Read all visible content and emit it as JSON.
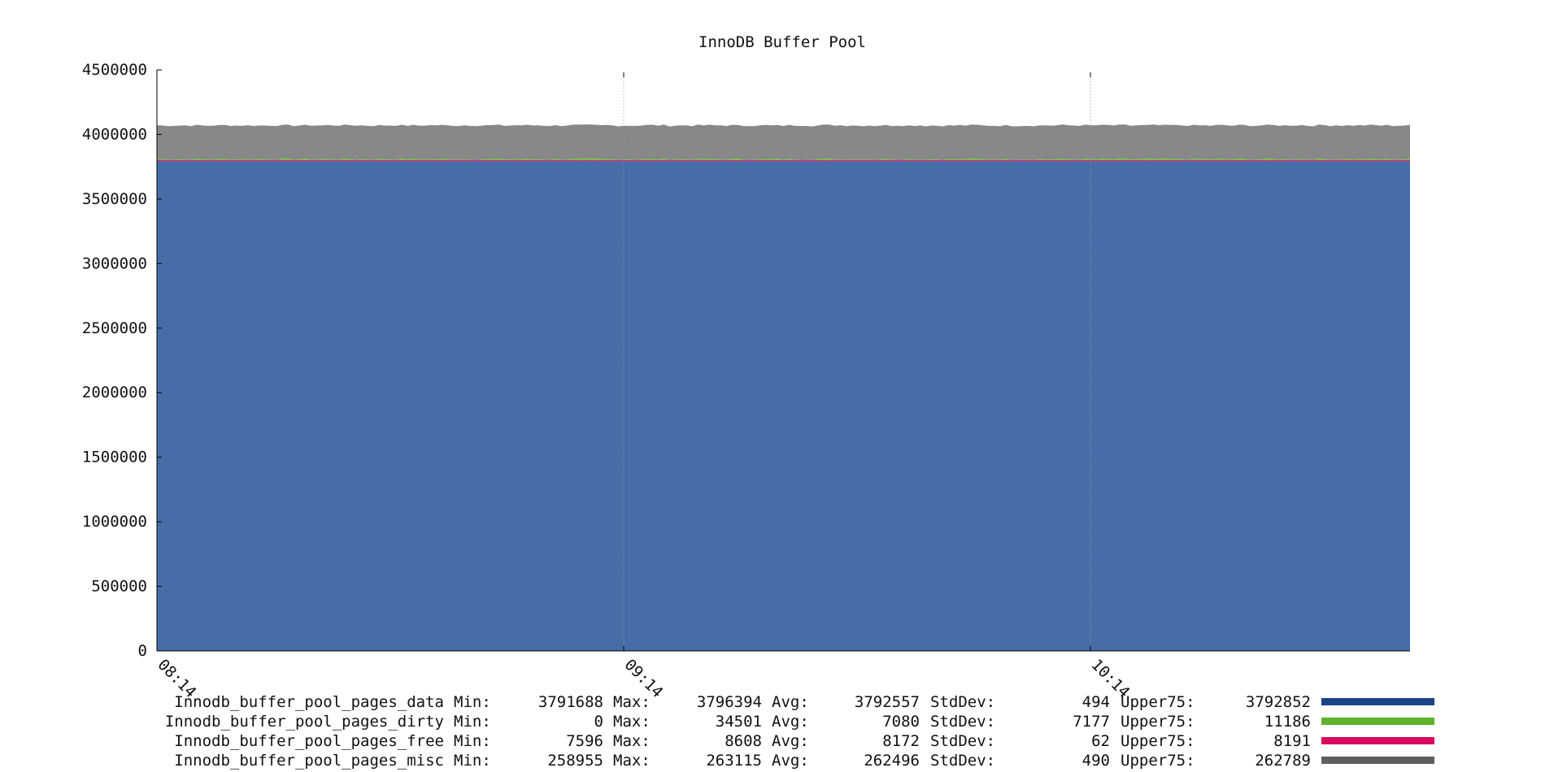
{
  "chart_data": {
    "type": "area",
    "stacked": true,
    "title": "InnoDB Buffer Pool",
    "xlabel": "",
    "ylabel": "",
    "ylim": [
      0,
      4500000
    ],
    "yticks": [
      "0",
      "500000",
      "1000000",
      "1500000",
      "2000000",
      "2500000",
      "3000000",
      "3500000",
      "4000000",
      "4500000"
    ],
    "yticks_values": [
      0,
      500000,
      1000000,
      1500000,
      2000000,
      2500000,
      3000000,
      3500000,
      4000000,
      4500000
    ],
    "xticks": [
      "08:14",
      "09:14",
      "10:14"
    ],
    "grid": false,
    "legend_position": "bottom",
    "series": [
      {
        "name": "Innodb_buffer_pool_pages_data",
        "color": "#1a4488",
        "fill_color": "#466da8",
        "stats": {
          "min_label": "Min:",
          "min": "3791688",
          "max_label": "Max:",
          "max": "3796394",
          "avg_label": "Avg:",
          "avg": "3792557",
          "stddev_label": "StdDev:",
          "stddev": "494",
          "upper75_label": "Upper75:",
          "upper75": "3792852"
        },
        "approx_value": 3792557
      },
      {
        "name": "Innodb_buffer_pool_pages_dirty",
        "color": "#5fb32a",
        "fill_color": "#76c043",
        "stats": {
          "min_label": "Min:",
          "min": "0",
          "max_label": "Max:",
          "max": "34501",
          "avg_label": "Avg:",
          "avg": "7080",
          "stddev_label": "StdDev:",
          "stddev": "7177",
          "upper75_label": "Upper75:",
          "upper75": "11186"
        },
        "approx_value": 7080
      },
      {
        "name": "Innodb_buffer_pool_pages_free",
        "color": "#d8085f",
        "fill_color": "#d8085f",
        "stats": {
          "min_label": "Min:",
          "min": "7596",
          "max_label": "Max:",
          "max": "8608",
          "avg_label": "Avg:",
          "avg": "8172",
          "stddev_label": "StdDev:",
          "stddev": "62",
          "upper75_label": "Upper75:",
          "upper75": "8191"
        },
        "approx_value": 8172
      },
      {
        "name": "Innodb_buffer_pool_pages_misc",
        "color": "#5f5f5f",
        "fill_color": "#888888",
        "stats": {
          "min_label": "Min:",
          "min": "258955",
          "max_label": "Max:",
          "max": "263115",
          "avg_label": "Avg:",
          "avg": "262496",
          "stddev_label": "StdDev:",
          "stddev": "490",
          "upper75_label": "Upper75:",
          "upper75": "262789"
        },
        "approx_value": 262496
      }
    ]
  }
}
